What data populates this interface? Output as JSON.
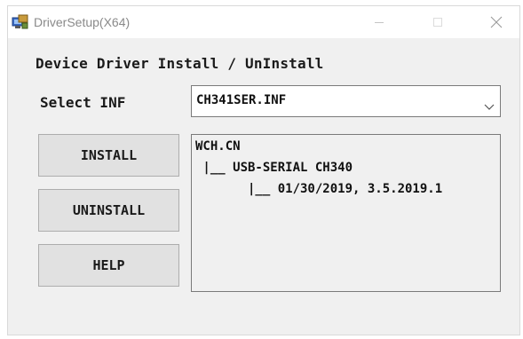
{
  "window": {
    "title": "DriverSetup(X64)",
    "app_icon": "driver-setup-icon",
    "controls": {
      "minimize": "minimize-icon",
      "maximize": "maximize-icon",
      "close": "close-icon"
    }
  },
  "main": {
    "heading": "Device Driver Install / UnInstall",
    "select_label": "Select INF",
    "inf_select": {
      "value": "CH341SER.INF",
      "dropdown_icon": "chevron-down-icon"
    },
    "buttons": {
      "install": "INSTALL",
      "uninstall": "UNINSTALL",
      "help": "HELP"
    },
    "info_lines": [
      "WCH.CN",
      " |__ USB-SERIAL CH340",
      "       |__ 01/30/2019, 3.5.2019.1"
    ]
  },
  "colors": {
    "window_bg": "#f0f0f0",
    "titlebar_bg": "#ffffff",
    "button_bg": "#e1e1e1",
    "border": "#7a7a7a"
  }
}
